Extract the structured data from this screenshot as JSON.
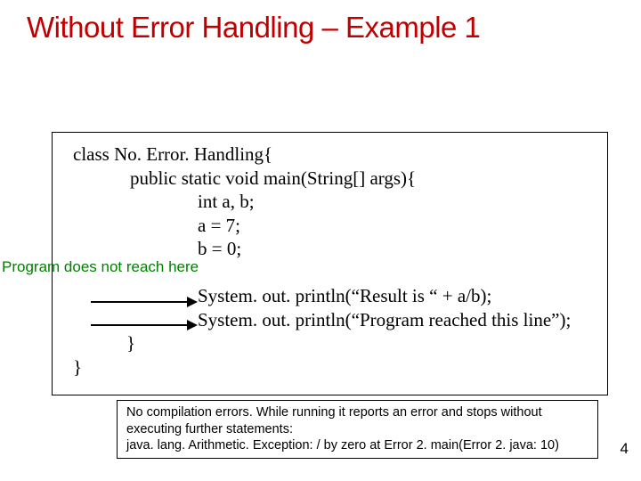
{
  "title": "Without Error Handling – Example 1",
  "code": {
    "l1": "class No. Error. Handling{",
    "l2": "public static void main(String[] args){",
    "l3": "int a, b;",
    "l4": "a = 7;",
    "l5": "b = 0;",
    "l6": "System. out. println(“Result is “ + a/b);",
    "l7": "System. out. println(“Program reached this line”);",
    "l8": "}",
    "l9": "}"
  },
  "annotation": "Program does not reach here",
  "note": {
    "line1": "No compilation errors. While running it reports an error and stops without",
    "line2": "executing further statements:",
    "line3": "java. lang. Arithmetic. Exception: / by zero at Error 2. main(Error 2. java: 10)"
  },
  "slide_number": "4"
}
